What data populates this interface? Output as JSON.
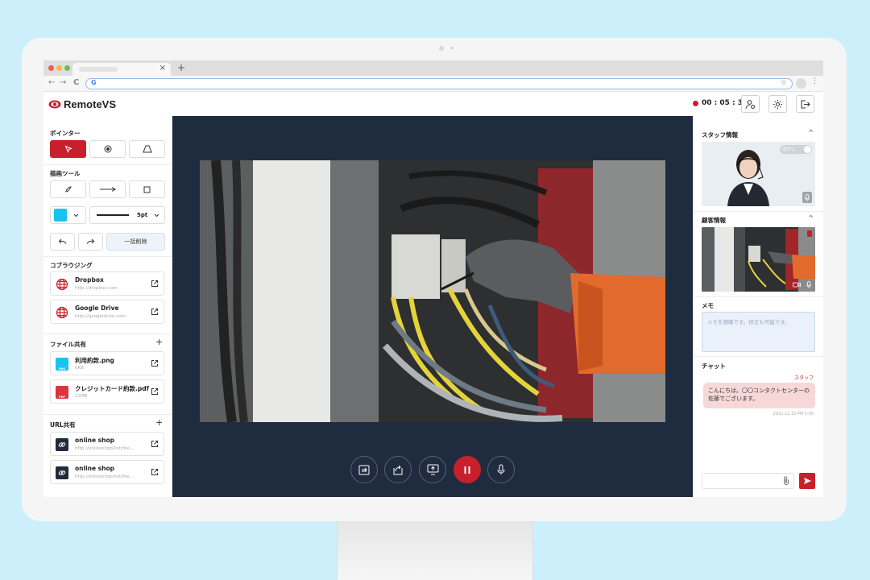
{
  "browser": {
    "tab_close": "×",
    "new_tab": "+",
    "back": "←",
    "forward": "→",
    "reload": "C",
    "google_letter": "G",
    "star": "☆",
    "menu": "⋮"
  },
  "header": {
    "logo_text": "RemoteVS",
    "timer": "00 : 05 : 32",
    "accent": "#c7202c"
  },
  "left": {
    "pointer_label": "ポインター",
    "drawing_label": "描画ツール",
    "color_value": "#19c3ee",
    "line_width": "5pt",
    "clear_all": "一括削除",
    "cobrowsing_label": "コブラウジング",
    "cobrowsing": [
      {
        "title": "Dropbox",
        "url": "http://dropbox.com"
      },
      {
        "title": "Google Drive",
        "url": "http://googledrive.com"
      }
    ],
    "file_label": "ファイル共有",
    "files": [
      {
        "title": "利用約款.png",
        "meta": "6KB",
        "badge": "PNG"
      },
      {
        "title": "クレジットカード約款.pdf",
        "meta": "12MB",
        "badge": "PDF"
      }
    ],
    "url_label": "URL共有",
    "urls": [
      {
        "title": "online shop",
        "url": "http://onlineshop/list/the..."
      },
      {
        "title": "online shop",
        "url": "http://onlineshop/list/the..."
      }
    ],
    "plus": "+"
  },
  "right": {
    "staff_label": "スタッフ情報",
    "customer_label": "顧客情報",
    "memo_label": "メモ",
    "memo_placeholder": "メモを御確です。修正も可能です。",
    "chat_label": "チャット",
    "chat_sender": "スタッフ",
    "chat_line1": "こんにちは。〇〇コンタクトセンターの",
    "chat_line2": "佐藤でございます。",
    "chat_time": "2022.11.15 PM 5:00",
    "toggle_label": "ぼかし",
    "chevron": "^"
  }
}
